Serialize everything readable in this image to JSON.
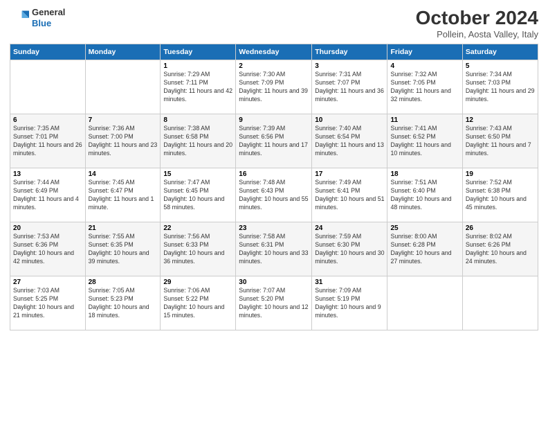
{
  "logo": {
    "general": "General",
    "blue": "Blue"
  },
  "title": "October 2024",
  "subtitle": "Pollein, Aosta Valley, Italy",
  "days_header": [
    "Sunday",
    "Monday",
    "Tuesday",
    "Wednesday",
    "Thursday",
    "Friday",
    "Saturday"
  ],
  "weeks": [
    [
      {
        "day": "",
        "info": ""
      },
      {
        "day": "",
        "info": ""
      },
      {
        "day": "1",
        "info": "Sunrise: 7:29 AM\nSunset: 7:11 PM\nDaylight: 11 hours and 42 minutes."
      },
      {
        "day": "2",
        "info": "Sunrise: 7:30 AM\nSunset: 7:09 PM\nDaylight: 11 hours and 39 minutes."
      },
      {
        "day": "3",
        "info": "Sunrise: 7:31 AM\nSunset: 7:07 PM\nDaylight: 11 hours and 36 minutes."
      },
      {
        "day": "4",
        "info": "Sunrise: 7:32 AM\nSunset: 7:05 PM\nDaylight: 11 hours and 32 minutes."
      },
      {
        "day": "5",
        "info": "Sunrise: 7:34 AM\nSunset: 7:03 PM\nDaylight: 11 hours and 29 minutes."
      }
    ],
    [
      {
        "day": "6",
        "info": "Sunrise: 7:35 AM\nSunset: 7:01 PM\nDaylight: 11 hours and 26 minutes."
      },
      {
        "day": "7",
        "info": "Sunrise: 7:36 AM\nSunset: 7:00 PM\nDaylight: 11 hours and 23 minutes."
      },
      {
        "day": "8",
        "info": "Sunrise: 7:38 AM\nSunset: 6:58 PM\nDaylight: 11 hours and 20 minutes."
      },
      {
        "day": "9",
        "info": "Sunrise: 7:39 AM\nSunset: 6:56 PM\nDaylight: 11 hours and 17 minutes."
      },
      {
        "day": "10",
        "info": "Sunrise: 7:40 AM\nSunset: 6:54 PM\nDaylight: 11 hours and 13 minutes."
      },
      {
        "day": "11",
        "info": "Sunrise: 7:41 AM\nSunset: 6:52 PM\nDaylight: 11 hours and 10 minutes."
      },
      {
        "day": "12",
        "info": "Sunrise: 7:43 AM\nSunset: 6:50 PM\nDaylight: 11 hours and 7 minutes."
      }
    ],
    [
      {
        "day": "13",
        "info": "Sunrise: 7:44 AM\nSunset: 6:49 PM\nDaylight: 11 hours and 4 minutes."
      },
      {
        "day": "14",
        "info": "Sunrise: 7:45 AM\nSunset: 6:47 PM\nDaylight: 11 hours and 1 minute."
      },
      {
        "day": "15",
        "info": "Sunrise: 7:47 AM\nSunset: 6:45 PM\nDaylight: 10 hours and 58 minutes."
      },
      {
        "day": "16",
        "info": "Sunrise: 7:48 AM\nSunset: 6:43 PM\nDaylight: 10 hours and 55 minutes."
      },
      {
        "day": "17",
        "info": "Sunrise: 7:49 AM\nSunset: 6:41 PM\nDaylight: 10 hours and 51 minutes."
      },
      {
        "day": "18",
        "info": "Sunrise: 7:51 AM\nSunset: 6:40 PM\nDaylight: 10 hours and 48 minutes."
      },
      {
        "day": "19",
        "info": "Sunrise: 7:52 AM\nSunset: 6:38 PM\nDaylight: 10 hours and 45 minutes."
      }
    ],
    [
      {
        "day": "20",
        "info": "Sunrise: 7:53 AM\nSunset: 6:36 PM\nDaylight: 10 hours and 42 minutes."
      },
      {
        "day": "21",
        "info": "Sunrise: 7:55 AM\nSunset: 6:35 PM\nDaylight: 10 hours and 39 minutes."
      },
      {
        "day": "22",
        "info": "Sunrise: 7:56 AM\nSunset: 6:33 PM\nDaylight: 10 hours and 36 minutes."
      },
      {
        "day": "23",
        "info": "Sunrise: 7:58 AM\nSunset: 6:31 PM\nDaylight: 10 hours and 33 minutes."
      },
      {
        "day": "24",
        "info": "Sunrise: 7:59 AM\nSunset: 6:30 PM\nDaylight: 10 hours and 30 minutes."
      },
      {
        "day": "25",
        "info": "Sunrise: 8:00 AM\nSunset: 6:28 PM\nDaylight: 10 hours and 27 minutes."
      },
      {
        "day": "26",
        "info": "Sunrise: 8:02 AM\nSunset: 6:26 PM\nDaylight: 10 hours and 24 minutes."
      }
    ],
    [
      {
        "day": "27",
        "info": "Sunrise: 7:03 AM\nSunset: 5:25 PM\nDaylight: 10 hours and 21 minutes."
      },
      {
        "day": "28",
        "info": "Sunrise: 7:05 AM\nSunset: 5:23 PM\nDaylight: 10 hours and 18 minutes."
      },
      {
        "day": "29",
        "info": "Sunrise: 7:06 AM\nSunset: 5:22 PM\nDaylight: 10 hours and 15 minutes."
      },
      {
        "day": "30",
        "info": "Sunrise: 7:07 AM\nSunset: 5:20 PM\nDaylight: 10 hours and 12 minutes."
      },
      {
        "day": "31",
        "info": "Sunrise: 7:09 AM\nSunset: 5:19 PM\nDaylight: 10 hours and 9 minutes."
      },
      {
        "day": "",
        "info": ""
      },
      {
        "day": "",
        "info": ""
      }
    ]
  ]
}
